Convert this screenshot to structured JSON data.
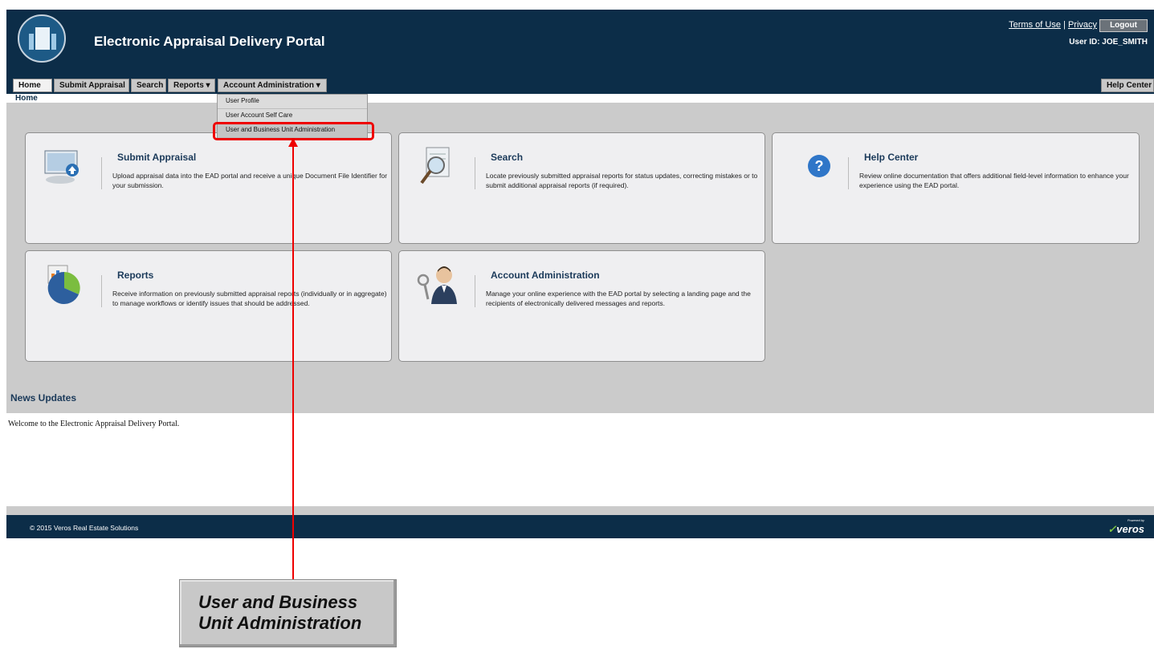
{
  "header": {
    "title": "Electronic Appraisal Delivery Portal",
    "terms_label": "Terms of Use",
    "separator": "|",
    "privacy_label": "Privacy",
    "logout_label": "Logout",
    "user_id": "User ID: JOE_SMITH"
  },
  "nav": {
    "tabs": [
      {
        "label": "Home"
      },
      {
        "label": "Submit Appraisal"
      },
      {
        "label": "Search"
      },
      {
        "label": "Reports ▾"
      },
      {
        "label": "Account Administration ▾"
      }
    ],
    "help_label": "Help Center"
  },
  "breadcrumb": "Home",
  "dropdown": {
    "items": [
      {
        "label": "User Profile"
      },
      {
        "label": "User Account Self Care"
      },
      {
        "label": "User and Business Unit Administration"
      }
    ]
  },
  "cards": [
    {
      "title": "Submit Appraisal",
      "description": "Upload appraisal data into the EAD portal and receive a unique Document File Identifier for your submission.",
      "icon": "monitor-upload-icon"
    },
    {
      "title": "Search",
      "description": "Locate previously submitted appraisal reports for status updates, correcting mistakes or to submit additional appraisal reports (if required).",
      "icon": "magnifier-document-icon"
    },
    {
      "title": "Help Center",
      "description": "Review online documentation that offers additional field-level information to enhance your experience using the EAD portal.",
      "icon": "question-icon"
    },
    {
      "title": "Reports",
      "description": "Receive information on previously submitted appraisal reports (individually or in aggregate) to manage workflows or identify issues that should be addressed.",
      "icon": "pie-chart-icon"
    },
    {
      "title": "Account Administration",
      "description": "Manage your online experience with the EAD portal by selecting a landing page and the recipients of electronically delivered messages and reports.",
      "icon": "user-keys-icon"
    }
  ],
  "news": {
    "title": "News Updates",
    "body": "Welcome to the Electronic Appraisal Delivery Portal."
  },
  "footer": {
    "copyright": "© 2015 Veros Real Estate Solutions",
    "powered_by": "Powered by",
    "brand": "veros"
  },
  "callout": {
    "text": "User and Business Unit Administration"
  },
  "colors": {
    "navy": "#0c2d48",
    "highlight": "#ee0000",
    "panel": "#cbcbcb"
  }
}
